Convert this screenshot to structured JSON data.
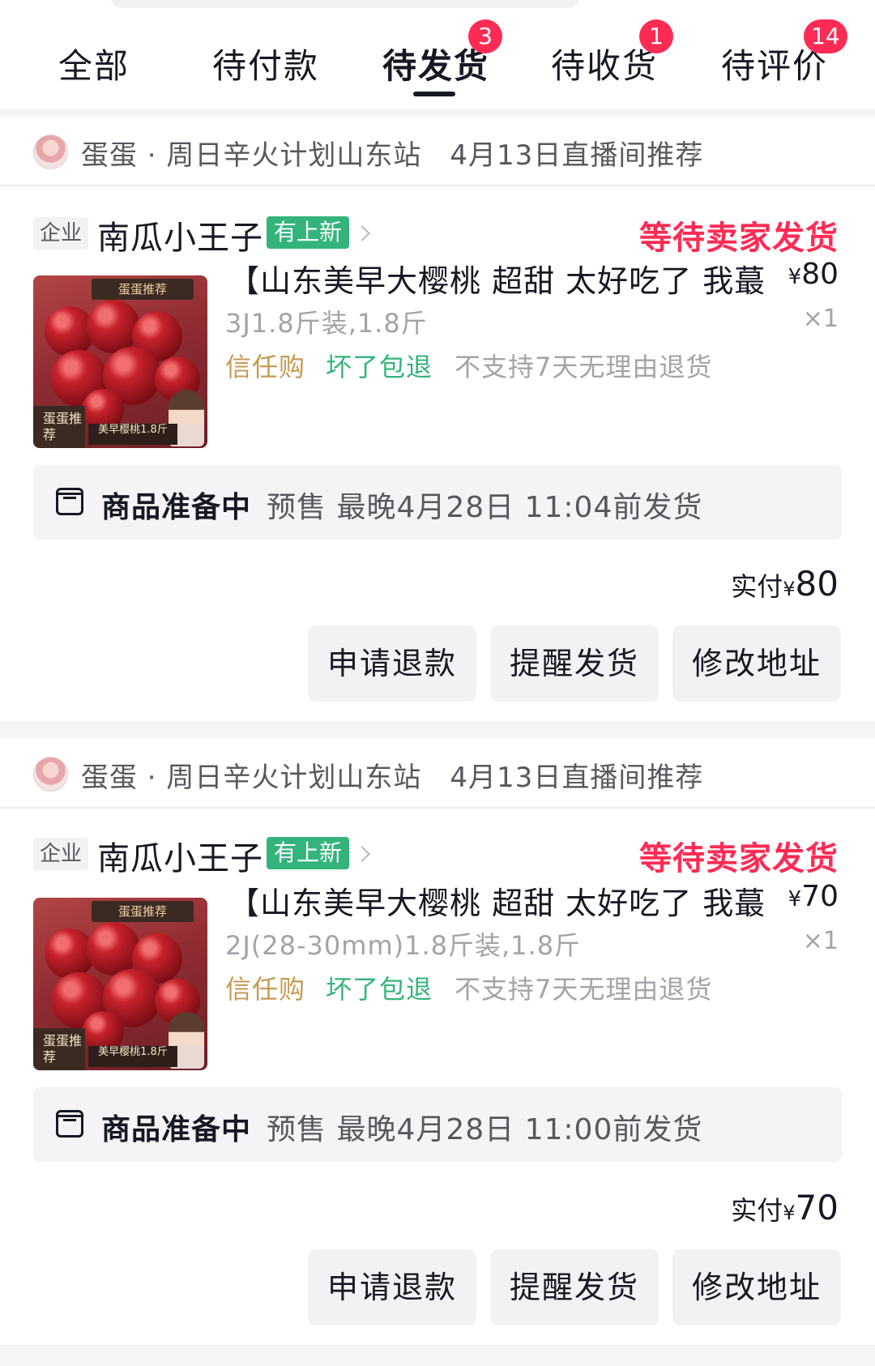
{
  "tabs": [
    {
      "label": "全部",
      "badge": ""
    },
    {
      "label": "待付款",
      "badge": ""
    },
    {
      "label": "待发货",
      "badge": "3",
      "active": true
    },
    {
      "label": "待收货",
      "badge": "1"
    },
    {
      "label": "待评价",
      "badge": "14"
    }
  ],
  "orders": [
    {
      "live_text": "蛋蛋 · 周日辛火计划山东站　4月13日直播间推荐",
      "shop_tag": "企业",
      "shop_name": "南瓜小王子",
      "new_tag": "有上新",
      "status": "等待卖家发货",
      "thumb": {
        "label_top": "蛋蛋推荐",
        "label_bl": "蛋蛋推荐",
        "label_bc": "美早樱桃1.8斤"
      },
      "title": "【山东美早大樱桃 超甜 太好吃了 我蕞",
      "price_symbol": "¥",
      "price": "80",
      "sku": "3J1.8斤装,1.8斤",
      "qty": "×1",
      "services": [
        "信任购",
        "坏了包退",
        "不支持7天无理由退货"
      ],
      "ship_title": "商品准备中",
      "ship_detail": "预售 最晚4月28日 11:04前发货",
      "paid_label": "实付",
      "paid_symbol": "¥",
      "paid_amount": "80",
      "buttons": [
        "申请退款",
        "提醒发货",
        "修改地址"
      ]
    },
    {
      "live_text": "蛋蛋 · 周日辛火计划山东站　4月13日直播间推荐",
      "shop_tag": "企业",
      "shop_name": "南瓜小王子",
      "new_tag": "有上新",
      "status": "等待卖家发货",
      "thumb": {
        "label_top": "蛋蛋推荐",
        "label_bl": "蛋蛋推荐",
        "label_bc": "美早樱桃1.8斤"
      },
      "title": "【山东美早大樱桃 超甜 太好吃了 我蕞",
      "price_symbol": "¥",
      "price": "70",
      "sku": "2J(28-30mm)1.8斤装,1.8斤",
      "qty": "×1",
      "services": [
        "信任购",
        "坏了包退",
        "不支持7天无理由退货"
      ],
      "ship_title": "商品准备中",
      "ship_detail": "预售 最晚4月28日 11:00前发货",
      "paid_label": "实付",
      "paid_symbol": "¥",
      "paid_amount": "70",
      "buttons": [
        "申请退款",
        "提醒发货",
        "修改地址"
      ]
    }
  ],
  "colors": {
    "accent_red": "#fe2c55",
    "new_green": "#34b47c",
    "trust_gold": "#c59a52"
  }
}
